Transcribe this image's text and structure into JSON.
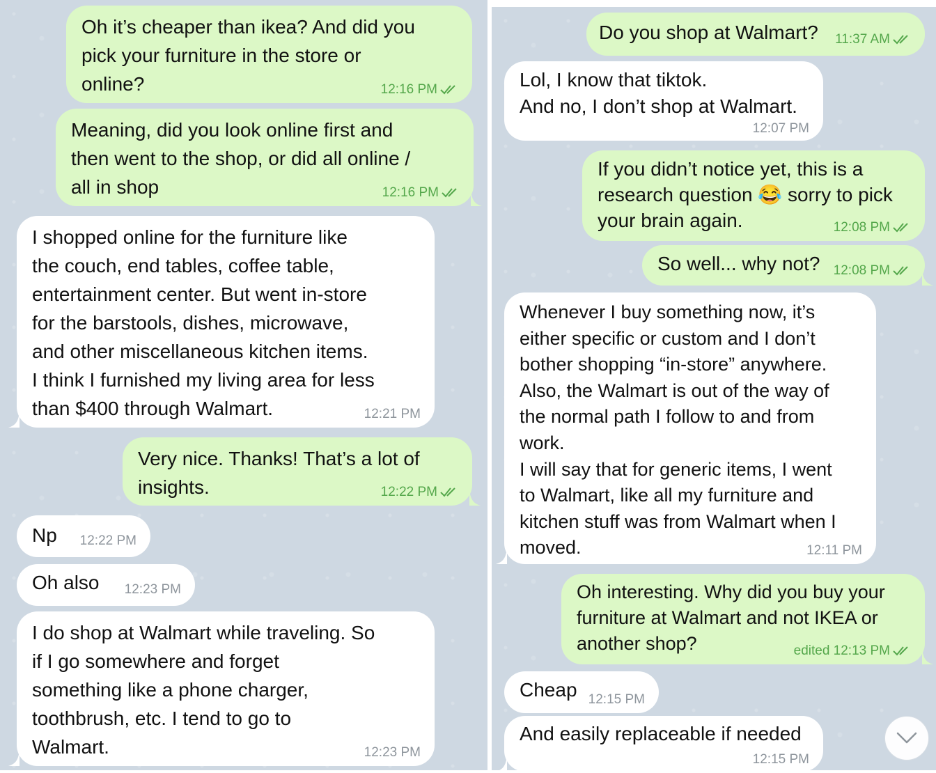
{
  "left": {
    "messages": [
      {
        "dir": "out",
        "text": "Oh it’s cheaper than ikea? And did you\npick your furniture in the store or\nonline?",
        "time": "12:16 PM",
        "read": true
      },
      {
        "dir": "out",
        "text": "Meaning, did you look online first and\nthen went to the shop, or did all online /\nall in shop",
        "time": "12:16 PM",
        "read": true
      },
      {
        "dir": "in",
        "text": "I shopped online for the furniture like\nthe couch, end tables, coffee table,\nentertainment center. But went in-store\nfor the barstools, dishes, microwave,\nand other miscellaneous kitchen items.\nI think I furnished my living area for less\nthan $400 through Walmart.",
        "time": "12:21 PM"
      },
      {
        "dir": "out",
        "text": "Very nice. Thanks! That’s a lot of\ninsights.",
        "time": "12:22 PM",
        "read": true
      },
      {
        "dir": "in",
        "text": "Np",
        "time": "12:22 PM"
      },
      {
        "dir": "in",
        "text": "Oh also",
        "time": "12:23 PM"
      },
      {
        "dir": "in",
        "text": "I do shop at Walmart while traveling. So\nif I go somewhere and forget\nsomething like a phone charger,\ntoothbrush, etc. I tend to go to\nWalmart.",
        "time": "12:23 PM"
      }
    ]
  },
  "right": {
    "messages": [
      {
        "dir": "out",
        "text": "Do you shop at Walmart?",
        "time": "11:37 AM",
        "read": true
      },
      {
        "dir": "in",
        "text": "Lol, I know that tiktok.\nAnd no, I don’t shop at Walmart.",
        "time": "12:07 PM"
      },
      {
        "dir": "out",
        "text": "If you didn’t notice yet, this is a\nresearch question 😂 sorry to pick\nyour brain again.",
        "time": "12:08 PM",
        "read": true
      },
      {
        "dir": "out",
        "text": "So well... why not?",
        "time": "12:08 PM",
        "read": true
      },
      {
        "dir": "in",
        "text": "Whenever I buy something now, it’s\neither specific or custom and I don’t\nbother shopping “in-store” anywhere.\nAlso, the Walmart is out of the way of\nthe normal path I follow to and from\nwork.\nI will say that for generic items, I went\nto Walmart, like all my furniture and\nkitchen stuff was from Walmart when I\nmoved.",
        "time": "12:11 PM"
      },
      {
        "dir": "out",
        "text": "Oh interesting. Why did you buy your\nfurniture at Walmart and not IKEA or\nanother shop?",
        "time": "edited 12:13 PM",
        "read": true
      },
      {
        "dir": "in",
        "text": "Cheap",
        "time": "12:15 PM"
      },
      {
        "dir": "in",
        "text": "And easily replaceable if needed",
        "time": "12:15 PM"
      }
    ],
    "scroll_down_icon": "chevron-down-icon"
  },
  "colors": {
    "wallpaper": "#ced8e2",
    "incoming_bubble": "#ffffff",
    "outgoing_bubble": "#dcf8c6",
    "outgoing_meta": "#54a74b",
    "incoming_meta": "#8e959c"
  }
}
